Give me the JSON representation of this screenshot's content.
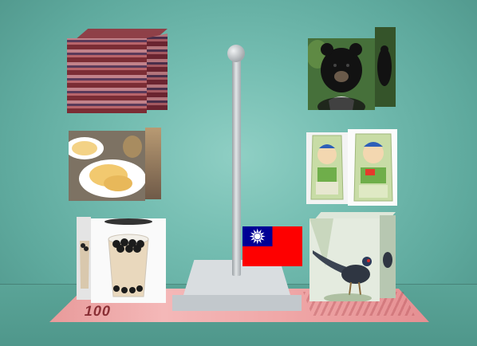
{
  "scene": {
    "banknote_number": "100"
  },
  "objects": {
    "cubes": [
      {
        "name": "fabric-pattern-cube"
      },
      {
        "name": "food-cube"
      },
      {
        "name": "bubble-tea-cube"
      },
      {
        "name": "black-bear-cube"
      },
      {
        "name": "rice-bag-cube"
      },
      {
        "name": "pheasant-cube"
      }
    ],
    "flag": {
      "name": "taiwan-flag"
    }
  },
  "colors": {
    "background": "#74bdb1",
    "flag_red": "#fe0000",
    "flag_blue": "#000095",
    "banknote": "#f0a8a8"
  }
}
